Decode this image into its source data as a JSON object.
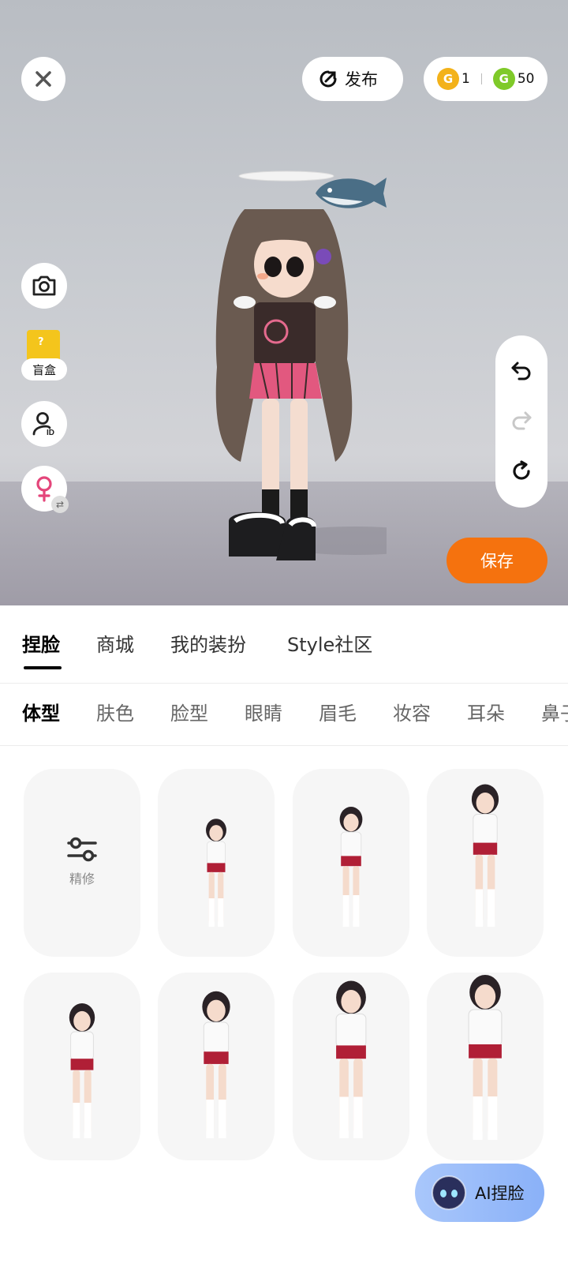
{
  "header": {
    "close_icon": "close-icon",
    "publish_label": "发布",
    "currency": {
      "gold_symbol": "G",
      "gold_count": "1",
      "green_symbol": "G",
      "green_count": "50"
    }
  },
  "left_tools": {
    "blind_box_label": "盲盒",
    "blind_box_symbol": "?",
    "icons": [
      "camera-icon",
      "blind-box-icon",
      "id-card-icon",
      "female-icon"
    ]
  },
  "right_tools": {
    "icons": [
      "undo-icon",
      "redo-icon",
      "reset-icon"
    ]
  },
  "save_label": "保存",
  "main_tabs": [
    {
      "label": "捏脸",
      "active": true
    },
    {
      "label": "商城",
      "active": false
    },
    {
      "label": "我的装扮",
      "active": false
    },
    {
      "label": "Style社区",
      "active": false
    }
  ],
  "sub_tabs": [
    {
      "label": "体型",
      "active": true
    },
    {
      "label": "肤色",
      "active": false
    },
    {
      "label": "脸型",
      "active": false
    },
    {
      "label": "眼睛",
      "active": false
    },
    {
      "label": "眉毛",
      "active": false
    },
    {
      "label": "妆容",
      "active": false
    },
    {
      "label": "耳朵",
      "active": false
    },
    {
      "label": "鼻子",
      "active": false
    }
  ],
  "grid": {
    "refine_label": "精修",
    "presets_count": 7
  },
  "ai_button_label": "AI捏脸",
  "colors": {
    "save": "#f5720e",
    "gold_coin": "#f3b21a",
    "green_coin": "#7fca29",
    "gender_pink": "#e4457a"
  }
}
